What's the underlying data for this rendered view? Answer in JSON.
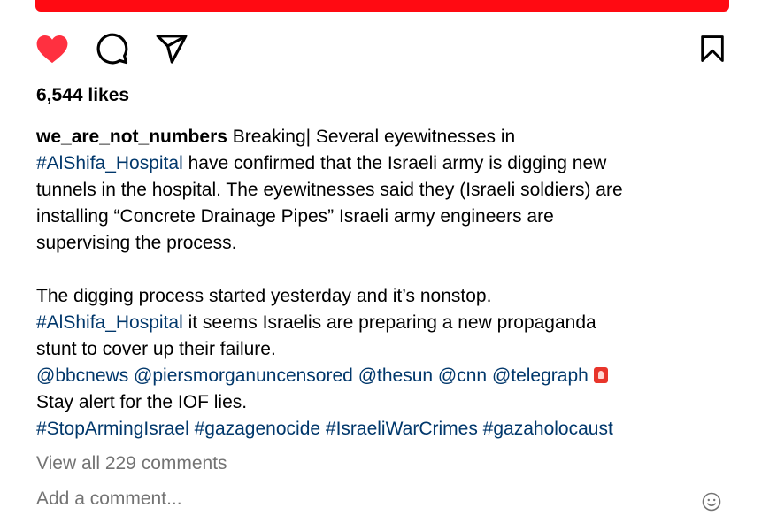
{
  "post": {
    "likes_text": "6,544 likes",
    "username": "we_are_not_numbers",
    "caption_parts": [
      {
        "text": "we_are_not_numbers",
        "kind": "user"
      },
      {
        "text": " Breaking| Several eyewitnesses in\n",
        "kind": "text"
      },
      {
        "text": "#AlShifa_Hospital",
        "kind": "tag"
      },
      {
        "text": " have confirmed that the Israeli army is digging new\ntunnels in the hospital. The eyewitnesses said they (Israeli soldiers) are\ninstalling “Concrete Drainage Pipes” Israeli army engineers are\nsupervising the process.\n\nThe digging process started yesterday and it’s nonstop.\n",
        "kind": "text"
      },
      {
        "text": "#AlShifa_Hospital",
        "kind": "tag"
      },
      {
        "text": " it seems Israelis are preparing a new propaganda\nstunt to cover up their failure.\n",
        "kind": "text"
      },
      {
        "text": "@bbcnews",
        "kind": "tag"
      },
      {
        "text": " ",
        "kind": "text"
      },
      {
        "text": "@piersmorganuncensored",
        "kind": "tag"
      },
      {
        "text": " ",
        "kind": "text"
      },
      {
        "text": "@thesun",
        "kind": "tag"
      },
      {
        "text": " ",
        "kind": "text"
      },
      {
        "text": "@cnn",
        "kind": "tag"
      },
      {
        "text": " ",
        "kind": "text"
      },
      {
        "text": "@telegraph",
        "kind": "tag"
      },
      {
        "text": " ",
        "kind": "text"
      },
      {
        "text": "",
        "kind": "siren"
      },
      {
        "text": "\nStay alert for the IOF lies.\n",
        "kind": "text"
      },
      {
        "text": "#StopArmingIsrael",
        "kind": "tag"
      },
      {
        "text": " ",
        "kind": "text"
      },
      {
        "text": "#gazagenocide",
        "kind": "tag"
      },
      {
        "text": " ",
        "kind": "text"
      },
      {
        "text": "#IsraeliWarCrimes",
        "kind": "tag"
      },
      {
        "text": " ",
        "kind": "text"
      },
      {
        "text": "#gazaholocaust",
        "kind": "tag"
      }
    ],
    "view_all_comments": "View all 229 comments",
    "add_comment_placeholder": "Add a comment..."
  },
  "icons": {
    "like": "heart-icon",
    "comment": "comment-icon",
    "share": "send-icon",
    "save": "bookmark-icon",
    "emoji": "smiley-icon",
    "siren": "siren-emoji"
  },
  "colors": {
    "liked": "#ff3040",
    "link": "#00376b",
    "muted": "#737373",
    "media_edge": "#ff0a12"
  }
}
